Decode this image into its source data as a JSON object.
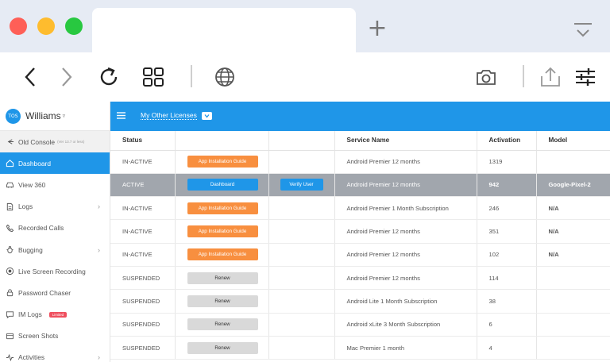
{
  "browser": {
    "new_tab_glyph": "+"
  },
  "sidebar": {
    "avatar_initials": "TOS",
    "user_name": "Williams",
    "user_caret": "▿",
    "items": [
      {
        "label": "Old Console",
        "sub": "(Ver 13.7 or less)",
        "icon": "back-arrow-icon"
      },
      {
        "label": "Dashboard",
        "icon": "home-icon"
      },
      {
        "label": "View 360",
        "icon": "car-icon"
      },
      {
        "label": "Logs",
        "icon": "document-icon",
        "chevron": "›"
      },
      {
        "label": "Recorded Calls",
        "icon": "phone-icon"
      },
      {
        "label": "Bugging",
        "icon": "bug-icon",
        "chevron": "›"
      },
      {
        "label": "Live Screen Recording",
        "icon": "record-icon"
      },
      {
        "label": "Password Chaser",
        "icon": "lock-icon"
      },
      {
        "label": "IM Logs",
        "icon": "chat-icon",
        "badge": "Limited"
      },
      {
        "label": "Screen Shots",
        "icon": "screenshot-icon"
      },
      {
        "label": "Activities",
        "icon": "activity-icon",
        "chevron": "›"
      }
    ]
  },
  "header": {
    "license_link": "My Other Licenses"
  },
  "table": {
    "columns": [
      "Status",
      "",
      "",
      "Service Name",
      "Activation",
      "Model"
    ],
    "rows": [
      {
        "status": "IN-ACTIVE",
        "action": "App Installation Guide",
        "action_style": "orange",
        "verify": "",
        "service": "Android Premier 12 months",
        "activation": "1319",
        "model": ""
      },
      {
        "status": "ACTIVE",
        "action": "Dashboard",
        "action_style": "blue",
        "verify": "Verify User",
        "service": "Android Premier 12 months",
        "activation": "942",
        "model": "Google-Pixel-2",
        "active": true
      },
      {
        "status": "IN-ACTIVE",
        "action": "App Installation Guide",
        "action_style": "orange",
        "verify": "",
        "service": "Android Premier 1 Month Subscription",
        "activation": "246",
        "model": "N/A"
      },
      {
        "status": "IN-ACTIVE",
        "action": "App Installation Guide",
        "action_style": "orange",
        "verify": "",
        "service": "Android Premier 12 months",
        "activation": "351",
        "model": "N/A"
      },
      {
        "status": "IN-ACTIVE",
        "action": "App Installation Guide",
        "action_style": "orange",
        "verify": "",
        "service": "Android Premier 12 months",
        "activation": "102",
        "model": "N/A"
      },
      {
        "status": "SUSPENDED",
        "action": "Renew",
        "action_style": "grey",
        "verify": "",
        "service": "Android Premier 12 months",
        "activation": "114",
        "model": ""
      },
      {
        "status": "SUSPENDED",
        "action": "Renew",
        "action_style": "grey",
        "verify": "",
        "service": "Android Lite 1 Month Subscription",
        "activation": "38",
        "model": ""
      },
      {
        "status": "SUSPENDED",
        "action": "Renew",
        "action_style": "grey",
        "verify": "",
        "service": "Android xLite 3 Month Subscription",
        "activation": "6",
        "model": ""
      },
      {
        "status": "SUSPENDED",
        "action": "Renew",
        "action_style": "grey",
        "verify": "",
        "service": "Mac Premier 1 month",
        "activation": "4",
        "model": ""
      }
    ]
  },
  "colors": {
    "accent": "#1f96e8",
    "orange_button": "#f88f3f",
    "active_row": "#a1a6ad",
    "badge": "#ef4f5e"
  }
}
